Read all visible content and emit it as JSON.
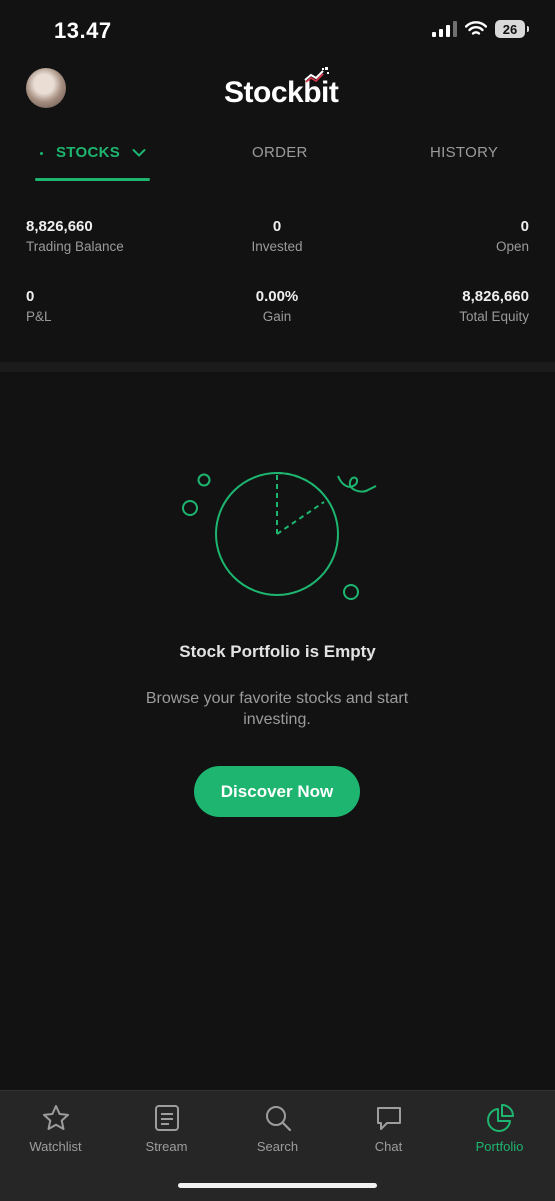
{
  "status": {
    "time": "13.47",
    "battery": "26"
  },
  "header": {
    "logo_text": "Stockbit"
  },
  "tabs": [
    {
      "label": "STOCKS",
      "active": true
    },
    {
      "label": "ORDER",
      "active": false
    },
    {
      "label": "HISTORY",
      "active": false
    }
  ],
  "stats": {
    "trading_balance": {
      "value": "8,826,660",
      "label": "Trading Balance"
    },
    "invested": {
      "value": "0",
      "label": "Invested"
    },
    "open": {
      "value": "0",
      "label": "Open"
    },
    "pnl": {
      "value": "0",
      "label": "P&L"
    },
    "gain": {
      "value": "0.00%",
      "label": "Gain"
    },
    "total_equity": {
      "value": "8,826,660",
      "label": "Total Equity"
    }
  },
  "empty_state": {
    "title": "Stock Portfolio is Empty",
    "description": "Browse your favorite stocks and start investing.",
    "button_label": "Discover Now"
  },
  "bottom_nav": [
    {
      "label": "Watchlist",
      "icon": "star-icon"
    },
    {
      "label": "Stream",
      "icon": "stream-icon"
    },
    {
      "label": "Search",
      "icon": "search-icon"
    },
    {
      "label": "Chat",
      "icon": "chat-icon"
    },
    {
      "label": "Portfolio",
      "icon": "pie-chart-icon",
      "active": true
    }
  ],
  "colors": {
    "accent": "#1db56f",
    "background": "#121212",
    "nav_background": "#262626"
  }
}
